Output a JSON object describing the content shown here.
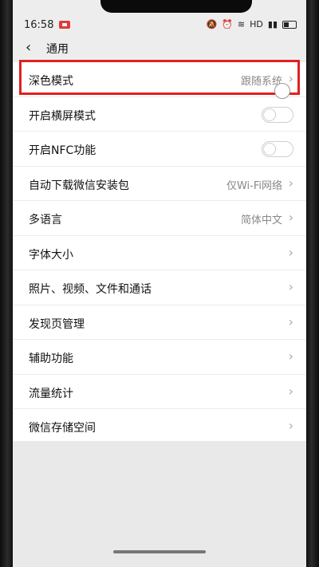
{
  "status_bar": {
    "time": "16:58",
    "network_label": "HD"
  },
  "header": {
    "back_icon": "chevron-left-icon",
    "title": "通用"
  },
  "rows": [
    {
      "label": "深色模式",
      "value": "跟随系统",
      "type": "link"
    },
    {
      "label": "开启横屏模式",
      "type": "toggle",
      "on": false
    },
    {
      "label": "开启NFC功能",
      "type": "toggle",
      "on": false
    },
    {
      "label": "自动下载微信安装包",
      "value": "仅Wi-Fi网络",
      "type": "link"
    },
    {
      "label": "多语言",
      "value": "简体中文",
      "type": "link"
    },
    {
      "label": "字体大小",
      "type": "link"
    },
    {
      "label": "照片、视频、文件和通话",
      "type": "link"
    },
    {
      "label": "发现页管理",
      "type": "link"
    },
    {
      "label": "辅助功能",
      "type": "link"
    },
    {
      "label": "流量统计",
      "type": "link"
    },
    {
      "label": "微信存储空间",
      "type": "link"
    }
  ],
  "colors": {
    "highlight": "#e02020",
    "background": "#ededed"
  }
}
